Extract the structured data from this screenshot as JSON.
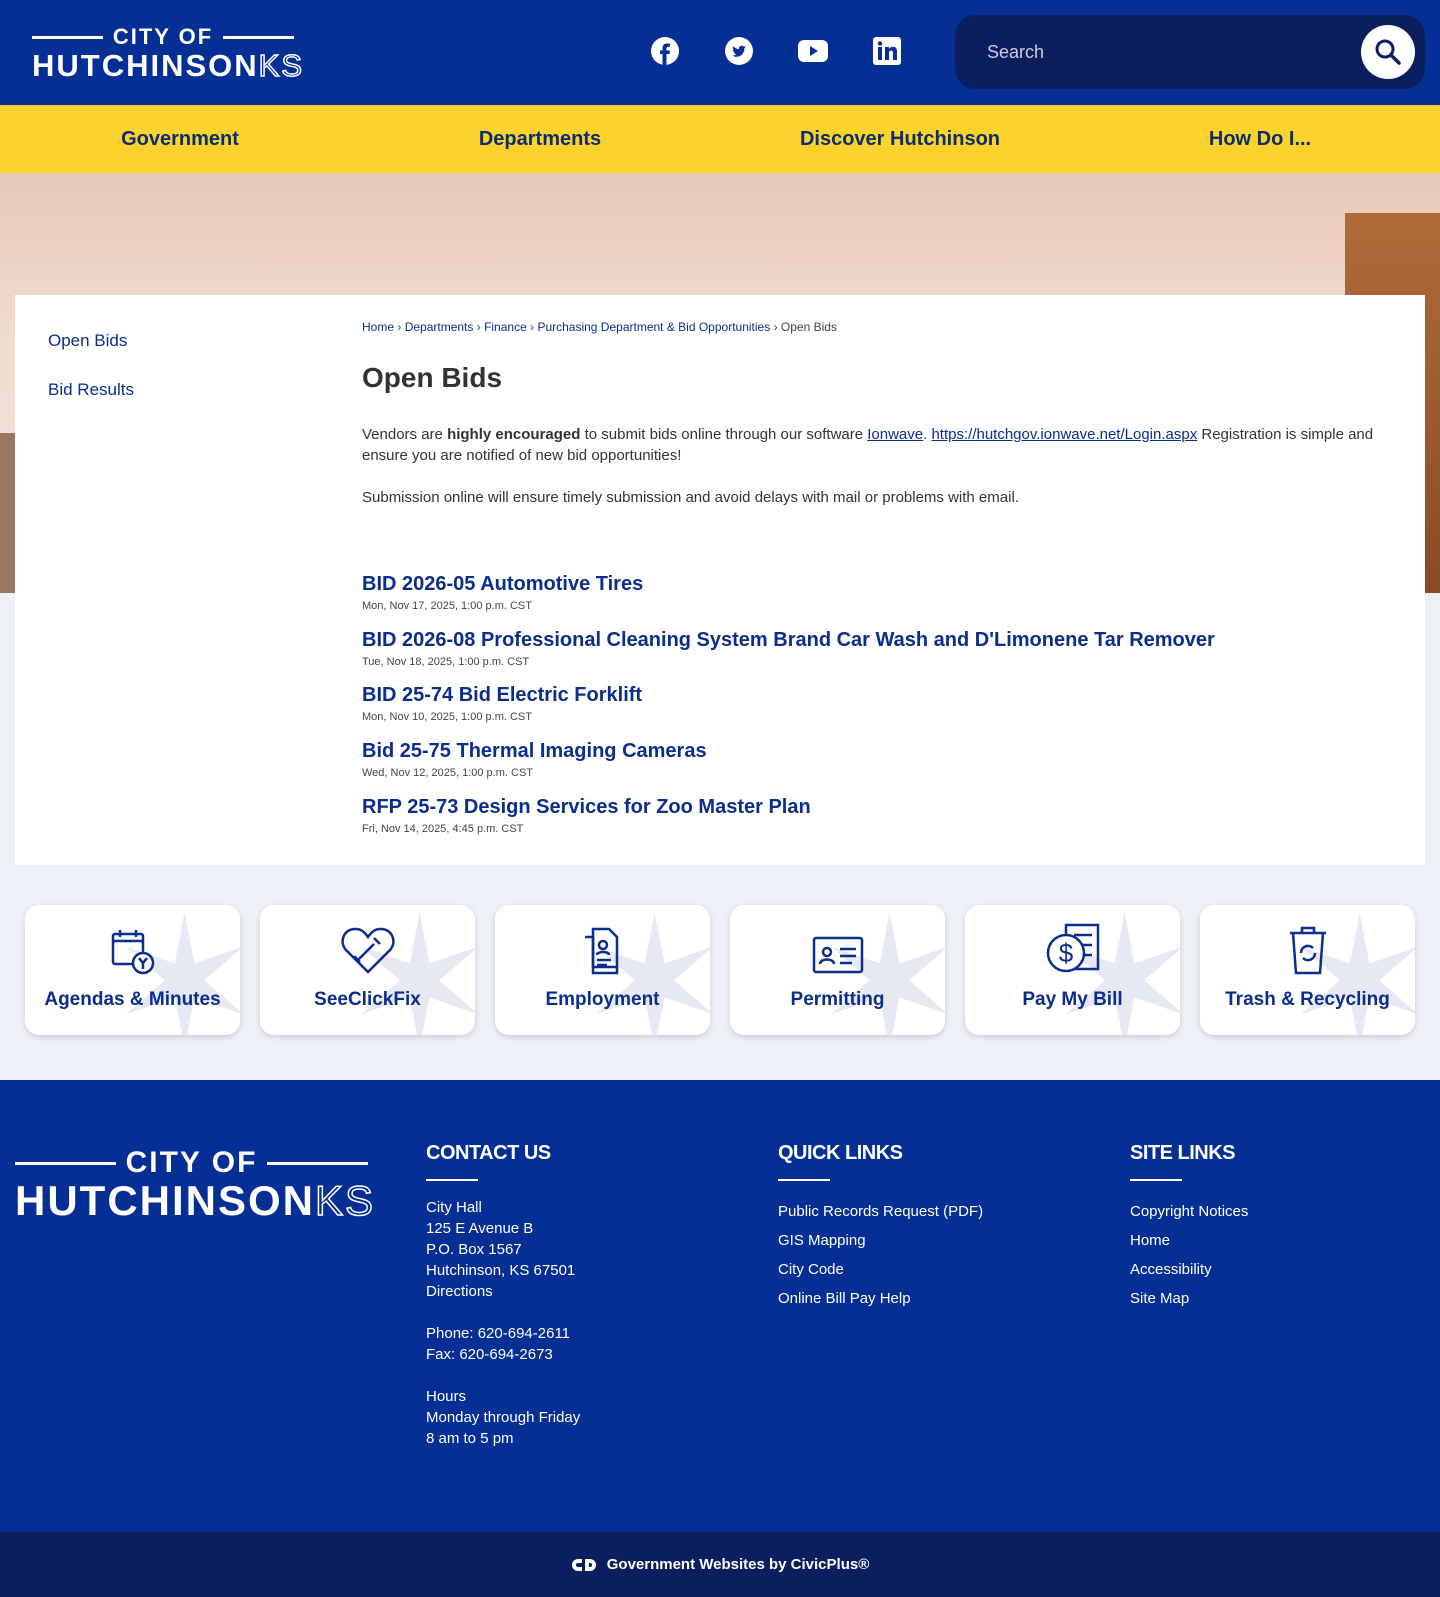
{
  "header": {
    "logo_top": "CITY OF",
    "logo_main": "HUTCHINSON",
    "logo_state": "KS",
    "search_placeholder": "Search"
  },
  "nav": [
    "Government",
    "Departments",
    "Discover Hutchinson",
    "How Do I..."
  ],
  "sidebar": [
    "Open Bids",
    "Bid Results"
  ],
  "breadcrumb": [
    "Home",
    "Departments",
    "Finance",
    "Purchasing Department & Bid Opportunities",
    "Open Bids"
  ],
  "title": "Open Bids",
  "intro": {
    "p1_a": "Vendors are ",
    "p1_bold": "highly encouraged",
    "p1_b": " to submit bids online through our software ",
    "link1": "Ionwave",
    "sep": ". ",
    "link2": "https://hutchgov.ionwave.net/Login.aspx",
    "p1_c": " Registration is simple and ensure you are notified of new bid opportunities!",
    "p2": "Submission online will ensure timely submission and avoid delays with mail or problems with email."
  },
  "bids": [
    {
      "title": "BID 2026-05 Automotive Tires",
      "date": "Mon, Nov 17, 2025, 1:00 p.m. CST"
    },
    {
      "title": "BID 2026-08 Professional Cleaning System Brand Car Wash and D'Limonene Tar Remover",
      "date": "Tue, Nov 18, 2025, 1:00 p.m. CST"
    },
    {
      "title": "BID 25-74 Bid Electric Forklift",
      "date": "Mon, Nov 10, 2025, 1:00 p.m. CST"
    },
    {
      "title": "Bid 25-75 Thermal Imaging Cameras",
      "date": "Wed, Nov 12, 2025, 1:00 p.m. CST"
    },
    {
      "title": "RFP 25-73 Design Services for Zoo Master Plan",
      "date": "Fri, Nov 14, 2025, 4:45 p.m. CST"
    }
  ],
  "tiles": [
    "Agendas & Minutes",
    "SeeClickFix",
    "Employment",
    "Permitting",
    "Pay My Bill",
    "Trash & Recycling"
  ],
  "footer": {
    "contact": {
      "heading": "CONTACT US",
      "lines": [
        "City Hall",
        "125 E Avenue B",
        "P.O. Box 1567",
        "Hutchinson, KS 67501",
        "Directions"
      ],
      "phone": "Phone: 620-694-2611",
      "fax": "Fax: 620-694-2673",
      "hours": [
        "Hours",
        "Monday through Friday",
        "8 am to 5 pm"
      ]
    },
    "quick": {
      "heading": "QUICK LINKS",
      "links": [
        "Public Records Request (PDF)",
        "GIS Mapping",
        "City Code",
        "Online Bill Pay Help"
      ]
    },
    "site": {
      "heading": "SITE LINKS",
      "links": [
        "Copyright Notices",
        "Home",
        "Accessibility",
        "Site Map"
      ]
    },
    "credit": "Government Websites by CivicPlus®"
  },
  "colors": {
    "primary": "#062f96",
    "accent": "#fcd22c",
    "dark": "#0b1f5e"
  }
}
